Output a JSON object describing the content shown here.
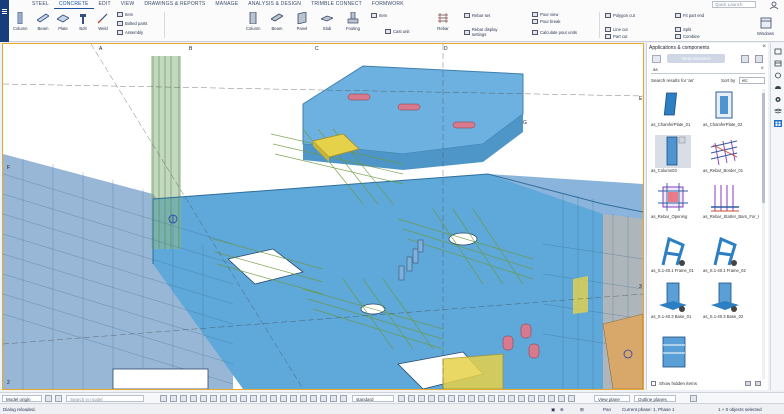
{
  "ribbon": {
    "tabs": [
      "STEEL",
      "CONCRETE",
      "EDIT",
      "VIEW",
      "DRAWINGS & REPORTS",
      "MANAGE",
      "ANALYSIS & DESIGN",
      "TRIMBLE CONNECT",
      "FORMWORK"
    ],
    "active_tab": "CONCRETE",
    "search_placeholder": "Quick Launch",
    "steel_buttons": [
      "Column",
      "Beam",
      "Plate",
      "Bolt",
      "Weld"
    ],
    "steel_small": [
      "Item",
      "Bolted parts",
      "Assembly"
    ],
    "concrete_buttons": [
      "Column",
      "Beam",
      "Panel",
      "Slab",
      "Footing",
      "Item",
      "Cast unit",
      "Rebar"
    ],
    "rebar_small": [
      "Rebar set",
      "Rebar display settings"
    ],
    "pour_small": [
      "Pour view",
      "Pour break",
      "Calculate pour units"
    ],
    "cut_small": [
      "Polygon cut",
      "Line cut",
      "Part cut",
      "Fit part end",
      "Split",
      "Combine"
    ],
    "windows_label": "Windows"
  },
  "viewport": {
    "grid_labels": [
      "A",
      "B",
      "C",
      "D",
      "E",
      "F",
      "G",
      "3",
      "2"
    ]
  },
  "panel": {
    "title": "Applications & components",
    "toolbar_pill": "Show extension",
    "search_value": "as",
    "results_label": "Search results for 'as'",
    "sort_by_label": "Sort by",
    "sort_value": "etc",
    "items": [
      {
        "name": "as_ChamferPlate_01",
        "icon": "plate-blue-icon"
      },
      {
        "name": "as_ChamferPlate_02",
        "icon": "plate-outline-icon"
      },
      {
        "name": "as_Column03",
        "icon": "column-icon"
      },
      {
        "name": "as_Rebar_Border_01",
        "icon": "rebar-cage-icon"
      },
      {
        "name": "as_Rebar_Opening",
        "icon": "rebar-opening-icon"
      },
      {
        "name": "as_Rebar_Starter_Bars_For_Wall_02",
        "icon": "rebar-starter-icon"
      },
      {
        "name": "as_S.1-40.1 Frame_01",
        "icon": "frame-icon"
      },
      {
        "name": "as_S.1-40.1 Frame_02",
        "icon": "frame-icon"
      },
      {
        "name": "as_S.1-40.3 Base_01",
        "icon": "base-icon"
      },
      {
        "name": "as_S.1-40.3 Base_02",
        "icon": "base-icon"
      },
      {
        "name": "as_S.1-40.4 ...",
        "icon": "stair-icon"
      }
    ],
    "show_hidden_label": "Show hidden items"
  },
  "bottom_toolbar": {
    "model_origin": "Model origin",
    "search_placeholder": "Search in model",
    "standard": "standard",
    "view_plane": "View plane",
    "outline_planes": "Outline planes"
  },
  "status": {
    "left": "Dialog reloaded.",
    "pan": "Pan",
    "phase": "Current phase: 1, Phase 1",
    "selection": "1 + 0 objects selected"
  },
  "colors": {
    "accent": "#1a4fa3",
    "slab": "#5aa7d9",
    "wall": "#7fa8cf",
    "rebar": "#6a9a3a",
    "highlight": "#e6d24a",
    "selection_border": "#e6a82a"
  }
}
